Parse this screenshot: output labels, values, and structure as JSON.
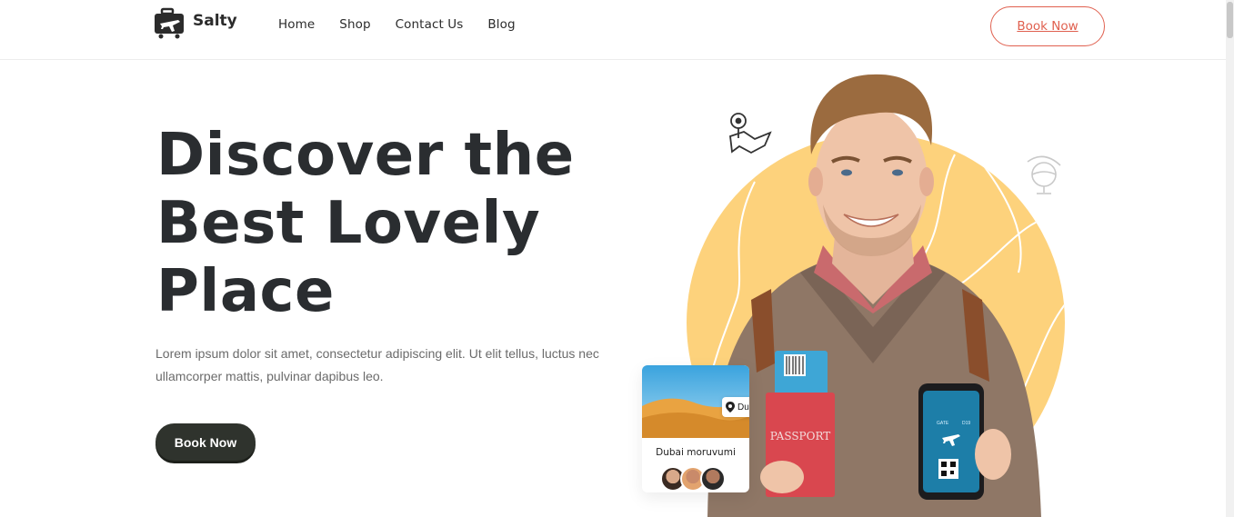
{
  "header": {
    "logo_text": "Salty",
    "nav": [
      "Home",
      "Shop",
      "Contact Us",
      "Blog"
    ],
    "book_label": "Book Now"
  },
  "hero": {
    "title_lines": [
      "Discover the",
      "Best Lovely",
      "Place"
    ],
    "description": "Lorem ipsum dolor sit amet, consectetur adipiscing elit. Ut elit tellus, luctus nec ullamcorper mattis, pulvinar dapibus leo.",
    "book_label": "Book Now"
  },
  "card": {
    "location": "Dubai",
    "title": "Dubai moruvumi"
  },
  "passport_text": "PASSPORT",
  "phone": {
    "gate_label": "GATE",
    "gate_value": "D19"
  },
  "colors": {
    "accent": "#e0604f",
    "dark_button": "#2f332d",
    "circle": "#fdd27c",
    "title": "#2a2d30"
  },
  "icons": [
    "suitcase-plane-icon",
    "map-pin-icon",
    "globe-icon",
    "location-pin-icon"
  ]
}
